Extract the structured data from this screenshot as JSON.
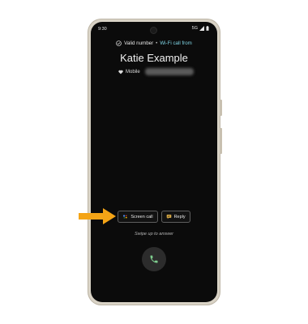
{
  "status_bar": {
    "time": "9:30",
    "network": "5G"
  },
  "call_screen": {
    "verification": "Valid number",
    "separator": "•",
    "wifi_call_label": "Wi-Fi call from",
    "caller_name": "Katie Example",
    "line_type": "Mobile"
  },
  "actions": {
    "screen_call_label": "Screen call",
    "reply_label": "Reply"
  },
  "swipe_hint": "Swipe up to answer",
  "colors": {
    "pointer_arrow": "#f4a416",
    "wifi_accent": "#7fd4e4",
    "answer_icon": "#7fcf8f",
    "screen_bg": "#0b0b0b"
  },
  "icons": {
    "verified": "check-circle-icon",
    "signal": "signal-icon",
    "battery": "battery-icon",
    "mobile": "heart-icon",
    "screen_call": "assistant-icon",
    "reply": "message-icon",
    "answer": "phone-icon"
  }
}
